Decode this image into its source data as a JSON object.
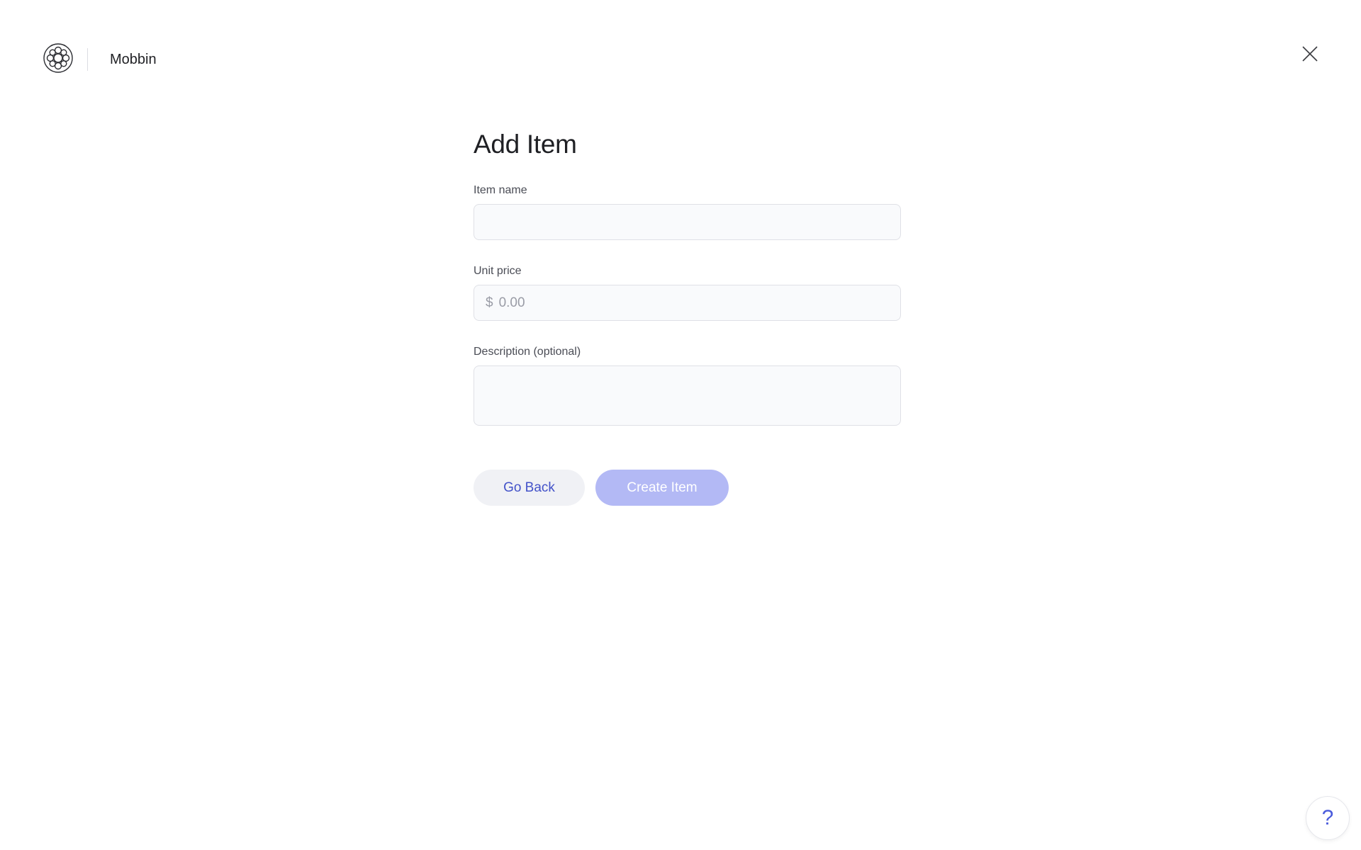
{
  "header": {
    "logo_icon": "wreath-logo-icon",
    "brand_name": "Mobbin",
    "close_icon": "close-icon"
  },
  "form": {
    "title": "Add Item",
    "item_name": {
      "label": "Item name",
      "value": "",
      "placeholder": ""
    },
    "unit_price": {
      "label": "Unit price",
      "currency_symbol": "$",
      "value": "",
      "placeholder": "0.00"
    },
    "description": {
      "label": "Description (optional)",
      "value": "",
      "placeholder": ""
    },
    "actions": {
      "back_label": "Go Back",
      "create_label": "Create Item"
    }
  },
  "help": {
    "label": "?",
    "icon": "question-mark-icon"
  },
  "colors": {
    "accent": "#4352c9",
    "create_button_disabled": "#b3b9f5",
    "secondary_button_bg": "#f0f1f5",
    "input_bg": "#f9fafc",
    "input_border": "#dfe0e6"
  }
}
